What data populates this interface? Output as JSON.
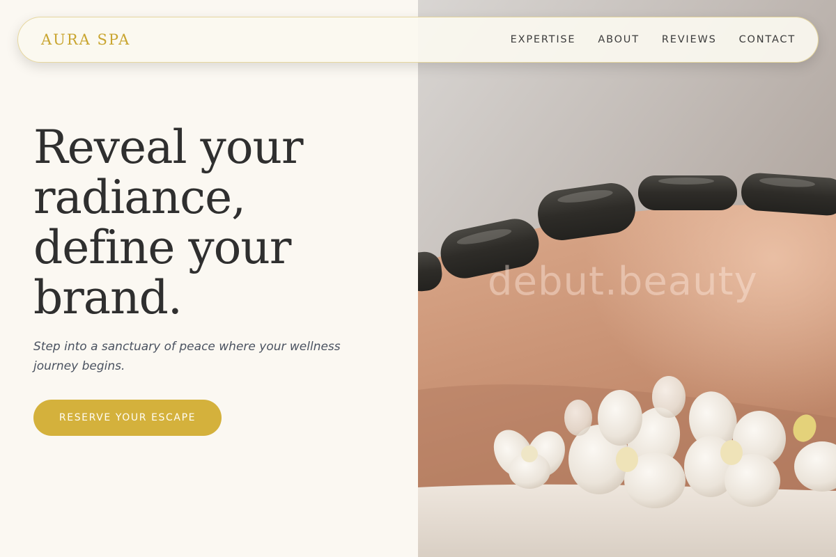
{
  "nav": {
    "logo": "AURA SPA",
    "links": [
      "EXPERTISE",
      "ABOUT",
      "REVIEWS",
      "CONTACT"
    ]
  },
  "hero": {
    "headline_lines": [
      "Reveal your",
      "radiance,",
      "define your",
      "brand."
    ],
    "subtitle": "Step into a sanctuary of peace where your wellness journey begins.",
    "cta_label": "RESERVE YOUR ESCAPE"
  },
  "image": {
    "watermark": "debut.beauty"
  },
  "colors": {
    "background": "#fbf8f2",
    "accent_gold": "#d4b13c",
    "logo_gold": "#c9a52f",
    "text_dark": "#2f2f2f",
    "subtitle_gray": "#4a5260"
  }
}
